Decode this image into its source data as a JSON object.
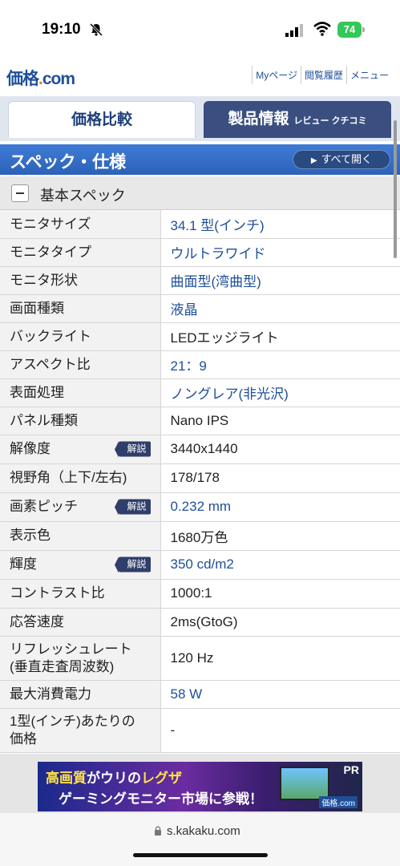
{
  "status_bar": {
    "time": "19:10",
    "battery": "74"
  },
  "header": {
    "logo_main": "価格",
    "logo_dot": ".",
    "logo_com": "com",
    "links": [
      "Myページ",
      "閲覧履歴",
      "メニュー"
    ]
  },
  "tabs": {
    "price": "価格比較",
    "product": "製品情報",
    "product_sub": "レビュー クチコミ"
  },
  "section": {
    "title": "スペック・仕様",
    "open_all": "すべて開く"
  },
  "subsection": {
    "title": "基本スペック"
  },
  "specs": [
    {
      "key": "モニタサイズ",
      "value": "34.1 型(インチ)",
      "link": true
    },
    {
      "key": "モニタタイプ",
      "value": "ウルトラワイド",
      "link": true
    },
    {
      "key": "モニタ形状",
      "value": "曲面型(湾曲型)",
      "link": true
    },
    {
      "key": "画面種類",
      "value": "液晶",
      "link": true
    },
    {
      "key": "バックライト",
      "value": "LEDエッジライト",
      "link": false
    },
    {
      "key": "アスペクト比",
      "value": "21：9",
      "link": true
    },
    {
      "key": "表面処理",
      "value": "ノングレア(非光沢)",
      "link": true
    },
    {
      "key": "パネル種類",
      "value": "Nano IPS",
      "link": false
    },
    {
      "key": "解像度",
      "value": "3440x1440",
      "link": false,
      "badge": "解説"
    },
    {
      "key": "視野角（上下/左右)",
      "value": "178/178",
      "link": false
    },
    {
      "key": "画素ピッチ",
      "value": "0.232 mm",
      "link": true,
      "badge": "解説"
    },
    {
      "key": "表示色",
      "value": "1680万色",
      "link": false
    },
    {
      "key": "輝度",
      "value": "350 cd/m2",
      "link": true,
      "badge": "解説"
    },
    {
      "key": "コントラスト比",
      "value": "1000:1",
      "link": false
    },
    {
      "key": "応答速度",
      "value": "2ms(GtoG)",
      "link": false
    },
    {
      "key": "リフレッシュレート(垂直走査周波数)",
      "value": "120 Hz",
      "link": false
    },
    {
      "key": "最大消費電力",
      "value": "58 W",
      "link": true
    },
    {
      "key": "1型(インチ)あたりの価格",
      "value": "-",
      "link": false
    }
  ],
  "ad": {
    "line1_a": "高画質",
    "line1_b": "がウリの",
    "line1_c": "レグザ",
    "line2": "ゲーミングモニター市場に参戦！",
    "pr": "PR",
    "logo": "価格.com"
  },
  "urlbar": {
    "url": "s.kakaku.com"
  }
}
